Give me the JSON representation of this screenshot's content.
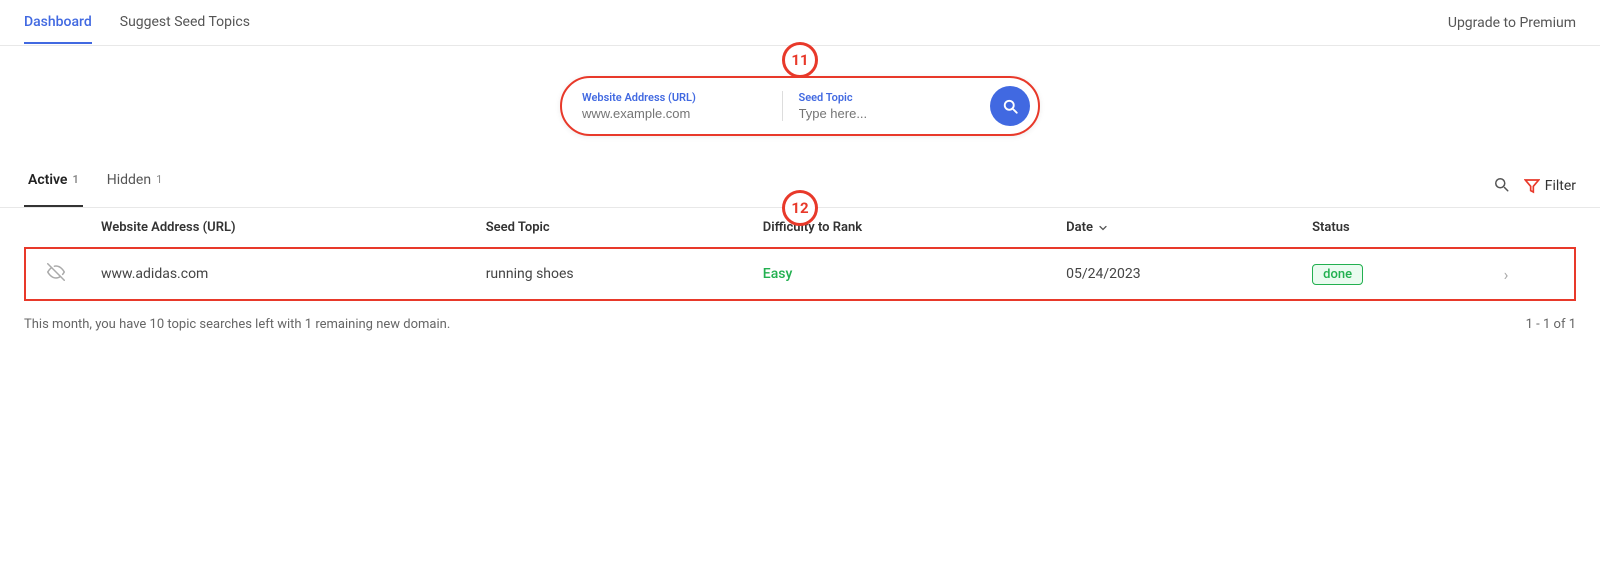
{
  "nav": {
    "items": [
      {
        "label": "Dashboard",
        "active": true
      },
      {
        "label": "Suggest Seed Topics",
        "active": false
      }
    ],
    "upgrade_label": "Upgrade to Premium"
  },
  "annotation_11": "11",
  "annotation_12": "12",
  "search": {
    "url_label": "Website Address (URL)",
    "url_placeholder": "www.example.com",
    "topic_label": "Seed Topic",
    "topic_placeholder": "Type here..."
  },
  "tabs": {
    "active_label": "Active",
    "active_count": "1",
    "hidden_label": "Hidden",
    "hidden_count": "1"
  },
  "filter": {
    "label": "Filter"
  },
  "table": {
    "headers": [
      {
        "key": "visibility",
        "label": ""
      },
      {
        "key": "url",
        "label": "Website Address (URL)"
      },
      {
        "key": "seed_topic",
        "label": "Seed Topic"
      },
      {
        "key": "difficulty",
        "label": "Difficulty to Rank"
      },
      {
        "key": "date",
        "label": "Date"
      },
      {
        "key": "status",
        "label": "Status"
      },
      {
        "key": "action",
        "label": ""
      }
    ],
    "rows": [
      {
        "url": "www.adidas.com",
        "seed_topic": "running shoes",
        "difficulty": "Easy",
        "date": "05/24/2023",
        "status": "done"
      }
    ]
  },
  "footer": {
    "message_prefix": "This month, you have ",
    "searches_left": "10",
    "message_mid": " topic searches left with ",
    "domains_left": "1",
    "message_suffix": " remaining new domain.",
    "pagination": "1 - 1 of 1"
  }
}
